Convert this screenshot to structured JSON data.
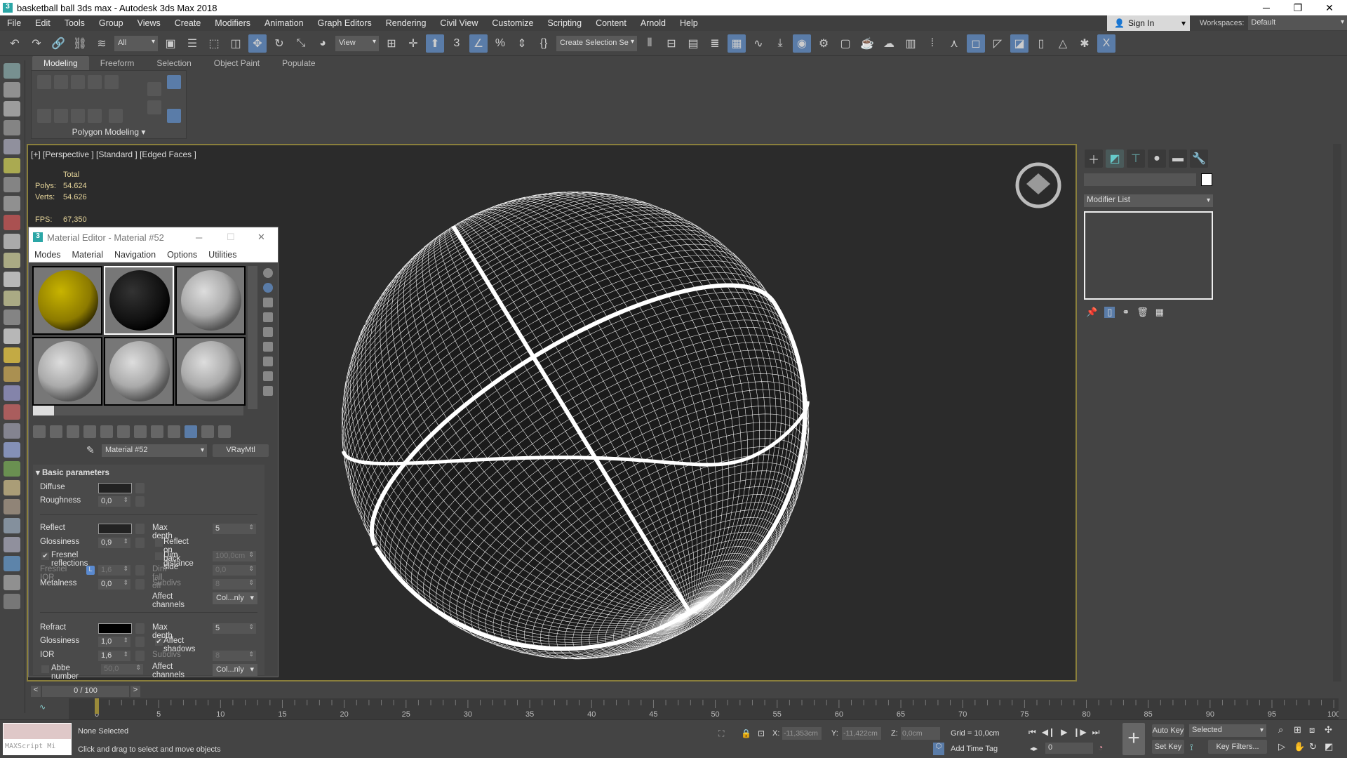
{
  "window": {
    "title": "basketball ball 3ds max - Autodesk 3ds Max 2018",
    "app_icon": "3"
  },
  "menu": [
    "File",
    "Edit",
    "Tools",
    "Group",
    "Views",
    "Create",
    "Modifiers",
    "Animation",
    "Graph Editors",
    "Rendering",
    "Civil View",
    "Customize",
    "Scripting",
    "Content",
    "Arnold",
    "Help"
  ],
  "account": {
    "sign_in": "Sign In",
    "workspaces_label": "Workspaces:",
    "workspace": "Default"
  },
  "toolbar": {
    "selection_filter": "All",
    "ref_coord": "View",
    "named_selection": "Create Selection Se"
  },
  "ribbon": {
    "tabs": [
      "Modeling",
      "Freeform",
      "Selection",
      "Object Paint",
      "Populate"
    ],
    "active": "Modeling",
    "panel_label": "Polygon Modeling"
  },
  "viewport": {
    "label": "[+] [Perspective ] [Standard ] [Edged Faces ]",
    "stats": {
      "total": "Total",
      "polys_label": "Polys:",
      "polys": "54.624",
      "verts_label": "Verts:",
      "verts": "54.626",
      "fps_label": "FPS:",
      "fps": "67,350"
    },
    "wire_color": "#ffffff",
    "border_color": "#8a7f3c"
  },
  "material_editor": {
    "title": "Material Editor - Material #52",
    "menus": [
      "Modes",
      "Material",
      "Navigation",
      "Options",
      "Utilities"
    ],
    "slots": [
      {
        "type": "yellow"
      },
      {
        "type": "black",
        "selected": true
      },
      {
        "type": "grey"
      },
      {
        "type": "grey"
      },
      {
        "type": "grey"
      },
      {
        "type": "grey"
      }
    ],
    "material_name": "Material #52",
    "material_type": "VRayMtl",
    "rollout": "Basic parameters",
    "diffuse": {
      "label": "Diffuse",
      "color": "#222222"
    },
    "roughness": {
      "label": "Roughness",
      "value": "0,0"
    },
    "reflect": {
      "label": "Reflect",
      "color": "#222222",
      "glossiness_label": "Glossiness",
      "glossiness": "0,9",
      "fresnel_label": "Fresnel reflections",
      "fresnel": true,
      "fresnel_ior_label": "Fresnel IOR",
      "fresnel_lock": "L",
      "fresnel_ior": "1,6",
      "metalness_label": "Metalness",
      "metalness": "0,0",
      "max_depth_label": "Max depth",
      "max_depth": "5",
      "back_side_label": "Reflect on back side",
      "dim_distance_label": "Dim distance",
      "dim_distance": "100,0cm",
      "dim_falloff_label": "Dim fall off",
      "dim_falloff": "0,0",
      "subdivs_label": "Subdivs",
      "subdivs": "8",
      "affect_label": "Affect channels",
      "affect": "Col...nly"
    },
    "refract": {
      "label": "Refract",
      "color": "#000000",
      "glossiness_label": "Glossiness",
      "glossiness": "1,0",
      "ior_label": "IOR",
      "ior": "1,6",
      "abbe_label": "Abbe number",
      "abbe": "50,0",
      "max_depth_label": "Max depth",
      "max_depth": "5",
      "shadows_label": "Affect shadows",
      "shadows": true,
      "subdivs_label": "Subdivs",
      "subdivs": "8",
      "affect_label": "Affect channels",
      "affect": "Col...nly"
    }
  },
  "command_panel": {
    "modifier_list": "Modifier List"
  },
  "timeline": {
    "frame": "0 / 100",
    "ticks": [
      "0",
      "5",
      "10",
      "15",
      "20",
      "25",
      "30",
      "35",
      "40",
      "45",
      "50",
      "55",
      "60",
      "65",
      "70",
      "75",
      "80",
      "85",
      "90",
      "95",
      "100"
    ]
  },
  "status": {
    "maxscript": "MAXScript Mi",
    "selection": "None Selected",
    "prompt": "Click and drag to select and move objects",
    "x_label": "X:",
    "x": "-11,353cm",
    "y_label": "Y:",
    "y": "-11,422cm",
    "z_label": "Z:",
    "z": "0,0cm",
    "grid": "Grid = 10,0cm",
    "add_time_tag": "Add Time Tag",
    "current_frame": "0",
    "auto_key": "Auto Key",
    "set_key": "Set Key",
    "key_mode": "Selected",
    "key_filters": "Key Filters..."
  }
}
